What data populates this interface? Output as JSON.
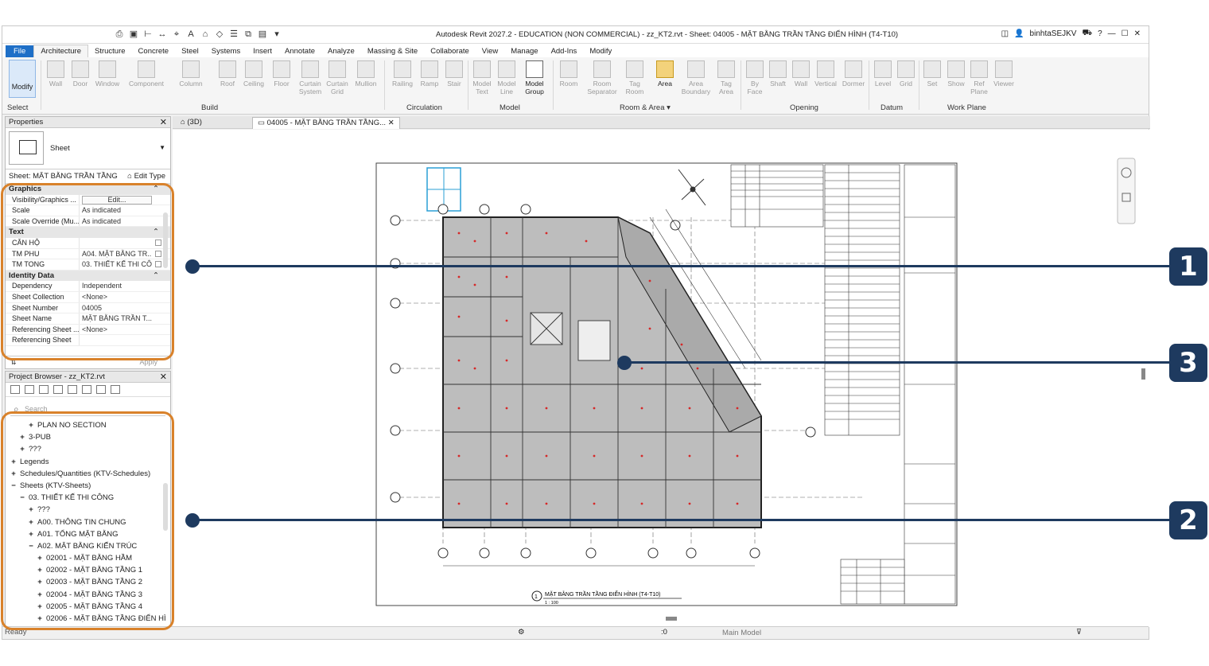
{
  "titlebar": {
    "title": "Autodesk Revit 2027.2 - EDUCATION (NON COMMERCIAL) - zz_KT2.rvt - Sheet: 04005 - MẶT BẰNG TRẦN TẦNG ĐIỂN HÌNH (T4-T10)",
    "user": "binhtaSEJKV"
  },
  "tabs": [
    "File",
    "Architecture",
    "Structure",
    "Concrete",
    "Steel",
    "Systems",
    "Insert",
    "Annotate",
    "Analyze",
    "Massing & Site",
    "Collaborate",
    "View",
    "Manage",
    "Add-Ins",
    "Modify"
  ],
  "ribbon": {
    "modify": "Modify",
    "select": "Select",
    "build": [
      "Wall",
      "Door",
      "Window",
      "Component",
      "Column",
      "Roof",
      "Ceiling",
      "Floor",
      "Curtain System",
      "Curtain Grid",
      "Mullion"
    ],
    "circulation": [
      "Railing",
      "Ramp",
      "Stair"
    ],
    "model": [
      "Model Text",
      "Model Line",
      "Model Group"
    ],
    "room_area": [
      "Room",
      "Room Separator",
      "Tag Room",
      "Area",
      "Area Boundary",
      "Tag Area"
    ],
    "opening": [
      "By Face",
      "Shaft",
      "Wall",
      "Vertical",
      "Dormer"
    ],
    "datum": [
      "Level",
      "Grid"
    ],
    "workplane": [
      "Set",
      "Show",
      "Ref Plane",
      "Viewer"
    ],
    "panels": {
      "build": "Build",
      "circulation": "Circulation",
      "model": "Model",
      "room_area": "Room & Area ▾",
      "opening": "Opening",
      "datum": "Datum",
      "workplane": "Work Plane"
    }
  },
  "properties": {
    "title": "Properties",
    "type_name": "Sheet",
    "sheet_selector": "Sheet: MẶT BẰNG TRẦN TẦNG",
    "edit_type": "Edit Type",
    "groups": [
      {
        "name": "Graphics",
        "rows": [
          {
            "k": "Visibility/Graphics ...",
            "v": "Edit..."
          },
          {
            "k": "Scale",
            "v": "As indicated"
          },
          {
            "k": "Scale Override (Mu...",
            "v": "As indicated"
          }
        ]
      },
      {
        "name": "Text",
        "rows": [
          {
            "k": "CĂN HỘ",
            "v": ""
          },
          {
            "k": "TM PHU",
            "v": "A04. MẶT BẰNG TR..."
          },
          {
            "k": "TM TONG",
            "v": "03. THIẾT KẾ THI CÔ..."
          }
        ]
      },
      {
        "name": "Identity Data",
        "rows": [
          {
            "k": "Dependency",
            "v": "Independent"
          },
          {
            "k": "Sheet Collection",
            "v": "<None>"
          },
          {
            "k": "Sheet Number",
            "v": "04005"
          },
          {
            "k": "Sheet Name",
            "v": "MẶT BẰNG TRẦN T..."
          },
          {
            "k": "Referencing Sheet ...",
            "v": "<None>"
          },
          {
            "k": "Referencing Sheet",
            "v": ""
          }
        ]
      }
    ],
    "apply": "Apply"
  },
  "browser": {
    "title": "Project Browser - zz_KT2.rvt",
    "search_placeholder": "Search",
    "items": [
      {
        "indent": 2,
        "pm": "+",
        "label": "PLAN NO SECTION"
      },
      {
        "indent": 1,
        "pm": "+",
        "label": "3-PUB"
      },
      {
        "indent": 1,
        "pm": "+",
        "label": "???"
      },
      {
        "indent": 0,
        "pm": "+",
        "label": "Legends"
      },
      {
        "indent": 0,
        "pm": "+",
        "label": "Schedules/Quantities (KTV-Schedules)"
      },
      {
        "indent": 0,
        "pm": "−",
        "label": "Sheets (KTV-Sheets)"
      },
      {
        "indent": 1,
        "pm": "−",
        "label": "03. THIẾT KẾ THI CÔNG"
      },
      {
        "indent": 2,
        "pm": "+",
        "label": "???"
      },
      {
        "indent": 2,
        "pm": "+",
        "label": "A00. THÔNG TIN CHUNG"
      },
      {
        "indent": 2,
        "pm": "+",
        "label": "A01. TỔNG MẶT BẰNG"
      },
      {
        "indent": 2,
        "pm": "−",
        "label": "A02. MẶT BẰNG KIẾN TRÚC"
      },
      {
        "indent": 3,
        "pm": "+",
        "label": "02001 - MẶT BẰNG HẦM"
      },
      {
        "indent": 3,
        "pm": "+",
        "label": "02002 - MẶT BẰNG TẦNG 1"
      },
      {
        "indent": 3,
        "pm": "+",
        "label": "02003 - MẶT BẰNG TẦNG 2"
      },
      {
        "indent": 3,
        "pm": "+",
        "label": "02004 - MẶT BẰNG TẦNG 3"
      },
      {
        "indent": 3,
        "pm": "+",
        "label": "02005 - MẶT BẰNG TẦNG 4"
      },
      {
        "indent": 3,
        "pm": "+",
        "label": "02006 - MẶT BẰNG TẦNG ĐIỂN HÌ"
      }
    ]
  },
  "view_tabs": {
    "tab1": "(3D)",
    "tab2": "04005 - MẶT BẰNG TRẦN TẦNG..."
  },
  "drawing": {
    "caption": "MẶT BẰNG TRẦN TẦNG ĐIỂN HÌNH (T4-T10)",
    "caption_num": "1",
    "scale": "1 : 100"
  },
  "statusbar": {
    "ready": "Ready",
    "model": "Main Model",
    "coord": ":0"
  },
  "callouts": [
    "1",
    "3",
    "2"
  ],
  "colors": {
    "highlight": "#d9822b",
    "callout": "#1e3a5f",
    "file_tab": "#1e6fc7"
  }
}
